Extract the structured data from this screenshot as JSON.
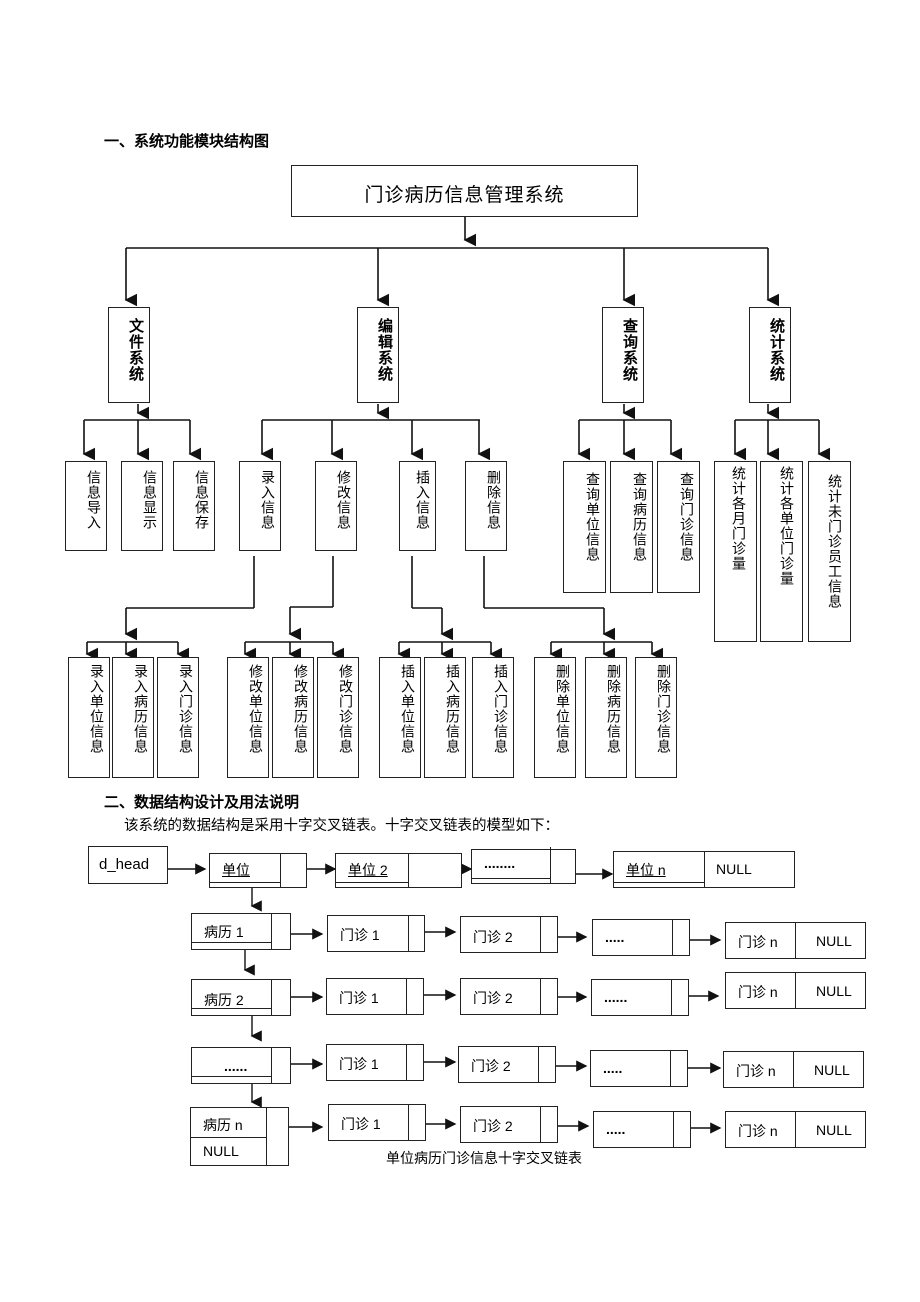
{
  "section1": {
    "heading": "一、系统功能模块结构图"
  },
  "tree": {
    "root": "门诊病历信息管理系统",
    "modules": [
      {
        "label": "文件系统",
        "children": [
          "信息导入",
          "信息显示",
          "信息保存"
        ]
      },
      {
        "label": "编辑系统",
        "children": [
          "录入信息",
          "修改信息",
          "插入信息",
          "删除信息"
        ]
      },
      {
        "label": "查询系统",
        "children": [
          "查询单位信息",
          "查询病历信息",
          "查询门诊信息"
        ]
      },
      {
        "label": "统计系统",
        "children": [
          "统计各月门诊量",
          "统计各单位门诊量",
          "统计未门诊员工信息"
        ]
      }
    ],
    "edit_leaves": [
      [
        "录入单位信息",
        "录入病历信息",
        "录入门诊信息"
      ],
      [
        "修改单位信息",
        "修改病历信息",
        "修改门诊信息"
      ],
      [
        "插入单位信息",
        "插入病历信息",
        "插入门诊信息"
      ],
      [
        "删除单位信息",
        "删除病历信息",
        "删除门诊信息"
      ]
    ]
  },
  "section2": {
    "heading": "二、数据结构设计及用法说明",
    "paragraph": "该系统的数据结构是采用十字交叉链表。十字交叉链表的模型如下："
  },
  "linked_list": {
    "head": "d_head",
    "units": [
      "单位",
      "单位 2",
      "........",
      "单位 n"
    ],
    "null": "NULL",
    "records": [
      "病历 1",
      "病历 2",
      "......",
      "病历 n"
    ],
    "visits": [
      "门诊 1",
      "门诊 2"
    ],
    "ellipsis_rows": [
      ".....",
      "......",
      ".....",
      "....."
    ],
    "visit_last": "门诊 n",
    "caption": "单位病历门诊信息十字交叉链表"
  }
}
